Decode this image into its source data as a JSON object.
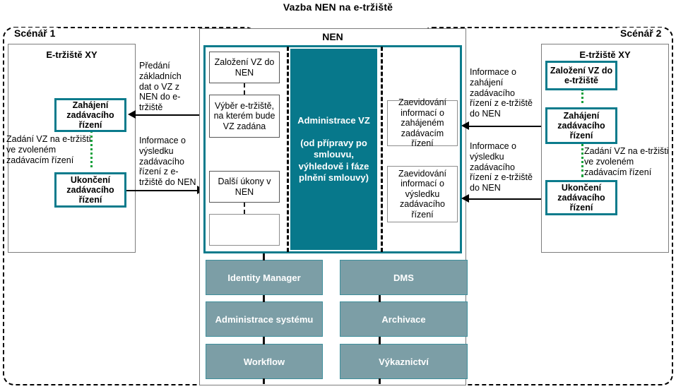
{
  "title": "Vazba NEN na e-tržiště",
  "scenario_left": {
    "label": "Scénář 1",
    "panel_title": "E-tržiště XY",
    "boxes": [
      {
        "name": "zahajeni",
        "text": "Zahájení zadávacího řízení"
      },
      {
        "name": "ukonceni",
        "text": "Ukončení zadávacího řízení"
      }
    ],
    "inline_note": "Zadání VZ na e-tržišti  ve zvoleném zadávacím řízení"
  },
  "scenario_right": {
    "label": "Scénář 2",
    "panel_title": "E-tržiště XY",
    "boxes": [
      {
        "name": "zalozeni",
        "text": "Založení VZ do e-tržiště"
      },
      {
        "name": "zahajeni",
        "text": "Zahájení zadávacího řízení"
      },
      {
        "name": "ukonceni",
        "text": "Ukončení zadávacího řízení"
      }
    ],
    "inline_note": "Zadání VZ na e-tržišti  ve zvoleném zadávacím řízení"
  },
  "nen": {
    "label": "NEN",
    "left_column_boxes": [
      {
        "name": "zalozeni-vz-do-nen",
        "text": "Založení VZ do NEN"
      },
      {
        "name": "vyber-e-trziste",
        "text": "Výběr e-tržiště, na kterém bude VZ zadána"
      },
      {
        "name": "dalsi-ukony",
        "text": "Další úkony v NEN"
      },
      {
        "name": "empty-box",
        "text": ""
      }
    ],
    "admin_block": {
      "heading": "Administrace VZ",
      "subtext": "(od přípravy po smlouvu, výhledově i fáze plnění smlouvy)"
    },
    "right_column_boxes": [
      {
        "name": "zaevidovani-zahajeni",
        "text": "Zaevidování informací o zahájeném zadávacím řízení"
      },
      {
        "name": "zaevidovani-vysledek",
        "text": "Zaevidování informací o výsledku zadávacího řízení"
      }
    ],
    "modules": [
      {
        "name": "identity-manager",
        "label": "Identity Manager"
      },
      {
        "name": "dms",
        "label": "DMS"
      },
      {
        "name": "administrace-systemu",
        "label": "Administrace systému"
      },
      {
        "name": "archivace",
        "label": "Archivace"
      },
      {
        "name": "workflow",
        "label": "Workflow"
      },
      {
        "name": "vykaznictvi",
        "label": "Výkaznictví"
      }
    ]
  },
  "flow_labels": {
    "left_top": "Předání základních dat o VZ z NEN do e-tržiště",
    "left_bottom": "Informace o výsledku zadávacího řízení z e-tržiště do NEN",
    "right_top": "Informace o zahájení zadávacího řízení z e-tržiště do NEN",
    "right_bottom": "Informace o výsledku zadávacího řízení z e-tržiště do NEN"
  },
  "colors": {
    "teal": "#0b7b8c",
    "teal_fill": "#07788b",
    "module_gray": "#7c9ea6",
    "green_dotted": "#15a03a",
    "panel_border": "#7d7d7d"
  }
}
